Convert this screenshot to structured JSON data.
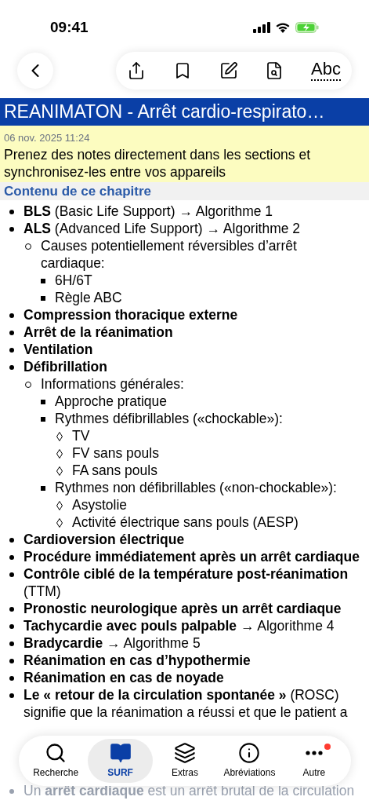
{
  "status_bar": {
    "time": "09:41"
  },
  "toolbar": {
    "abc_label": "Abc"
  },
  "title": "REANIMATON - Arrêt cardio-respirato…",
  "note": {
    "date": "06 nov. 2025 11:24",
    "text": "Prenez des notes directement dans les sections et synchronisez-les entre vos appareils"
  },
  "section_title": "Contenu de ce chapitre",
  "items": [
    {
      "text": "**BLS** (Basic Life Support) → Algorithme 1"
    },
    {
      "text": "**ALS** (Advanced Life Support) → Algorithme 2",
      "children": [
        {
          "text": "Causes potentiellement réversibles d’arrêt cardiaque:",
          "children": [
            {
              "text": "6H/6T"
            },
            {
              "text": "Règle ABC"
            }
          ]
        }
      ]
    },
    {
      "text": "**Compression thoracique externe**"
    },
    {
      "text": "**Arrêt de la réanimation**"
    },
    {
      "text": "**Ventilation**"
    },
    {
      "text": "**Défibrillation**",
      "children": [
        {
          "text": "Informations générales:",
          "children": [
            {
              "text": "Approche pratique"
            },
            {
              "text": "Rythmes défibrillables («chockable»):",
              "children": [
                {
                  "text": "TV"
                },
                {
                  "text": "FV sans pouls"
                },
                {
                  "text": "FA sans pouls"
                }
              ]
            },
            {
              "text": "Rythmes non défibrillables («non-chockable»):",
              "children": [
                {
                  "text": "Asystolie"
                },
                {
                  "text": "Activité électrique sans pouls (AESP)"
                }
              ]
            }
          ]
        }
      ]
    },
    {
      "text": "**Cardioversion électrique**"
    },
    {
      "text": "**Procédure immédiatement après un arrêt cardiaque**"
    },
    {
      "text": "**Contrôle ciblé de la température post-réanimation** (TTM)"
    },
    {
      "text": "**Pronostic neurologique après un arrêt cardiaque**"
    },
    {
      "text": "**Tachycardie avec pouls palpable** → Algorithme 4"
    },
    {
      "text": "**Bradycardie** → Algorithme 5"
    },
    {
      "text": "**Réanimation en cas d’hypothermie**"
    },
    {
      "text": "**Réanimation en cas de noyade**"
    },
    {
      "text": "**Le « retour de la circulation spontanée »** (ROSC) signifie que la réanimation a réussi et que le patient a"
    }
  ],
  "next_section": {
    "text": "Un **arrêt cardiaque** est un arrêt brutal de la circulation"
  },
  "tab_bar": [
    {
      "label": "Recherche",
      "kind": "search",
      "selected": false,
      "badge": false
    },
    {
      "label": "SURF",
      "kind": "book",
      "selected": true,
      "badge": false
    },
    {
      "label": "Extras",
      "kind": "layers",
      "selected": false,
      "badge": false
    },
    {
      "label": "Abréviations",
      "kind": "info",
      "selected": false,
      "badge": false
    },
    {
      "label": "Autre",
      "kind": "more",
      "selected": false,
      "badge": true
    }
  ]
}
